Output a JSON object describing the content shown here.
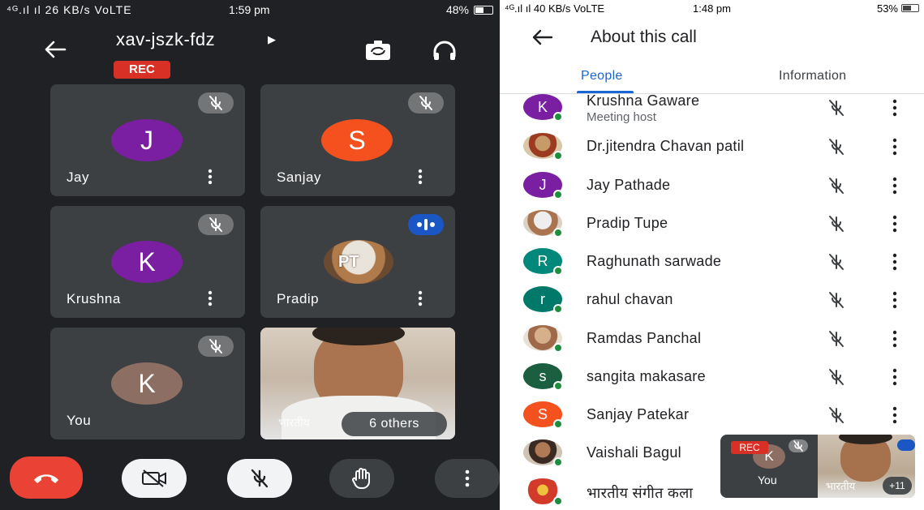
{
  "left_phone": {
    "status_bar": {
      "signal": "⁴ᴳ.ıl ıl 26 KB/s VoLTE",
      "time": "1:59 pm",
      "battery": "48%"
    },
    "meeting_code": "xav-jszk-fdz",
    "rec_label": "REC",
    "tiles": [
      {
        "name": "Jay",
        "initial": "J",
        "color": "#7b1fa2",
        "muted": true
      },
      {
        "name": "Sanjay",
        "initial": "S",
        "color": "#f4511e",
        "muted": true
      },
      {
        "name": "Krushna",
        "initial": "K",
        "color": "#7b1fa2",
        "muted": true
      },
      {
        "name": "Pradip",
        "initial": "PT",
        "color": "#8d6e63",
        "muted": false,
        "speaking": true
      },
      {
        "name": "You",
        "initial": "K",
        "color": "#8d6e63",
        "muted": true
      },
      {
        "name": "भारतीय",
        "others_label": "6 others"
      }
    ]
  },
  "right_phone": {
    "status_bar": {
      "signal": "⁴ᴳ.ıl ıl 40 KB/s VoLTE",
      "time": "1:48 pm",
      "battery": "53%"
    },
    "title": "About this call",
    "tabs": [
      "People",
      "Information"
    ],
    "participants": [
      {
        "name": "Krushna Gaware",
        "subtitle": "Meeting host",
        "initial": "K",
        "color": "#7b1fa2"
      },
      {
        "name": "Dr.jitendra Chavan patil",
        "photo": true
      },
      {
        "name": "Jay Pathade",
        "initial": "J",
        "color": "#7b1fa2"
      },
      {
        "name": "Pradip Tupe",
        "photo": true
      },
      {
        "name": "Raghunath sarwade",
        "initial": "R",
        "color": "#00897b"
      },
      {
        "name": "rahul chavan",
        "initial": "r",
        "color": "#00796b"
      },
      {
        "name": "Ramdas Panchal",
        "photo": true
      },
      {
        "name": "sangita makasare",
        "initial": "s",
        "color": "#1b5e40"
      },
      {
        "name": "Sanjay Patekar",
        "initial": "S",
        "color": "#f4511e"
      },
      {
        "name": "Vaishali Bagul",
        "photo": true
      },
      {
        "name": "भारतीय संगीत कला",
        "photo": true
      }
    ],
    "pip": {
      "rec": "REC",
      "initial": "K",
      "you": "You",
      "caption": "भारतीय",
      "count": "+11"
    }
  }
}
